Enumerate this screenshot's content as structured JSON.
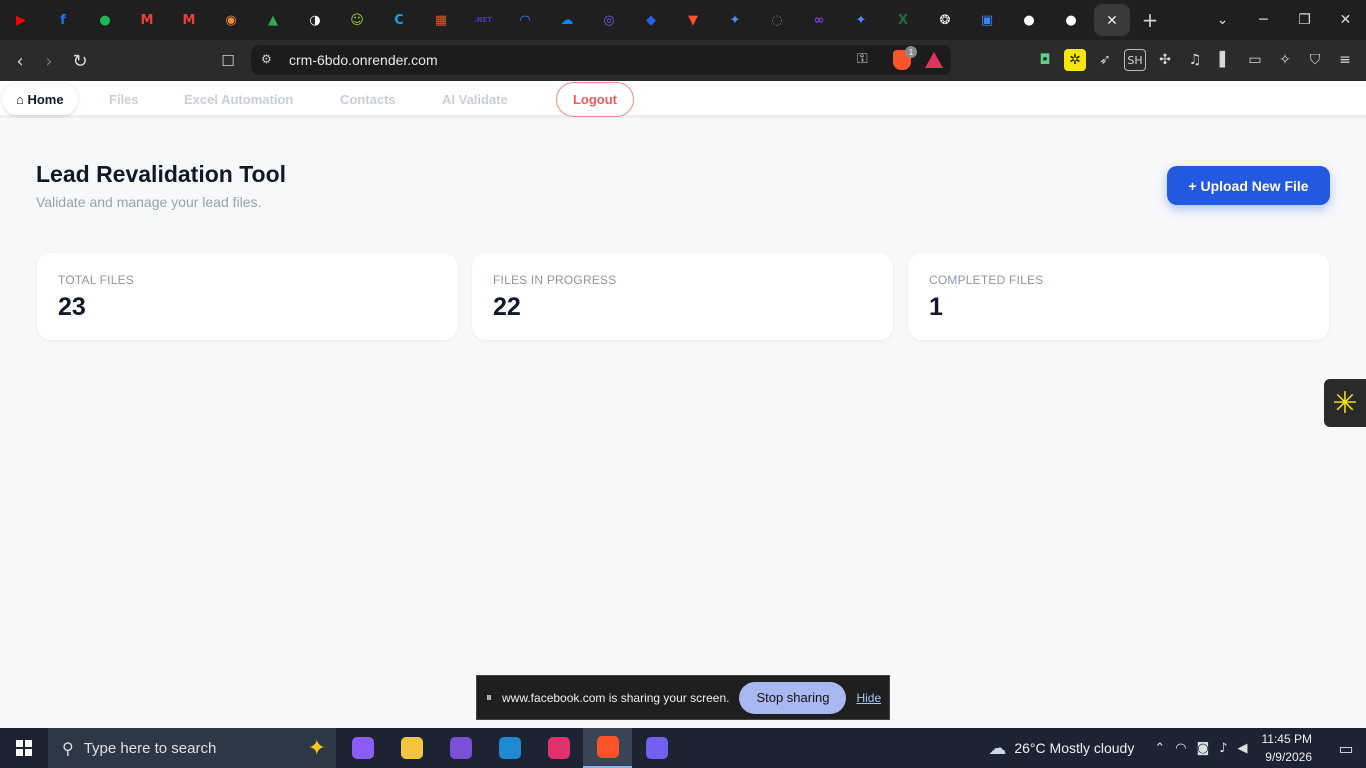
{
  "browser": {
    "tab_favicons": [
      {
        "name": "youtube",
        "color": "#ff0000",
        "glyph": "▶"
      },
      {
        "name": "facebook",
        "color": "#1877f2",
        "glyph": "f"
      },
      {
        "name": "chat",
        "color": "#1db954",
        "glyph": "●"
      },
      {
        "name": "gmail",
        "color": "#ea4335",
        "glyph": "M"
      },
      {
        "name": "gmail",
        "color": "#ea4335",
        "glyph": "M"
      },
      {
        "name": "app-orange",
        "color": "#f08c3a",
        "glyph": "◉"
      },
      {
        "name": "drive",
        "color": "#34a853",
        "glyph": "▲"
      },
      {
        "name": "app-bw",
        "color": "#ffffff",
        "glyph": "◑"
      },
      {
        "name": "app-green",
        "color": "#9acd32",
        "glyph": "☺"
      },
      {
        "name": "app-c",
        "color": "#0ea5e9",
        "glyph": "C"
      },
      {
        "name": "microsoft",
        "color": "#f25022",
        "glyph": "▦"
      },
      {
        "name": "dotnet",
        "color": "#512bd4",
        "glyph": ".NET"
      },
      {
        "name": "app-arc",
        "color": "#3b82f6",
        "glyph": "◠"
      },
      {
        "name": "onedrive",
        "color": "#0a84ff",
        "glyph": "☁"
      },
      {
        "name": "app-ring",
        "color": "#6366f1",
        "glyph": "◎"
      },
      {
        "name": "app-blue",
        "color": "#2563eb",
        "glyph": "◆"
      },
      {
        "name": "brave",
        "color": "#fb542b",
        "glyph": "▼"
      },
      {
        "name": "gemini",
        "color": "#4f8bff",
        "glyph": "✦"
      },
      {
        "name": "app-dotted",
        "color": "#777777",
        "glyph": "◌"
      },
      {
        "name": "meta",
        "color": "#7c3aed",
        "glyph": "∞"
      },
      {
        "name": "gemini",
        "color": "#4f8bff",
        "glyph": "✦"
      },
      {
        "name": "excel",
        "color": "#1d6f42",
        "glyph": "X"
      },
      {
        "name": "openai",
        "color": "#ffffff",
        "glyph": "❂"
      },
      {
        "name": "app-grid",
        "color": "#3b82f6",
        "glyph": "▣"
      },
      {
        "name": "github",
        "color": "#ffffff",
        "glyph": "●"
      },
      {
        "name": "github",
        "color": "#ffffff",
        "glyph": "●"
      }
    ],
    "active_tab_close": "✕",
    "new_tab": "+",
    "url": "crm-6bdo.onrender.com",
    "shield_badge": "1"
  },
  "app": {
    "nav": {
      "home": "⌂ Home",
      "files": "Files",
      "excel": "Excel Automation",
      "contacts": "Contacts",
      "ai_validate": "AI Validate",
      "logout": "Logout"
    },
    "title": "Lead Revalidation Tool",
    "subtitle": "Validate and manage your lead files.",
    "upload_button": "+ Upload New File",
    "stats": [
      {
        "label": "TOTAL FILES",
        "value": "23"
      },
      {
        "label": "FILES IN PROGRESS",
        "value": "22"
      },
      {
        "label": "COMPLETED FILES",
        "value": "1"
      }
    ]
  },
  "share_banner": {
    "text": "www.facebook.com is sharing your screen.",
    "stop": "Stop sharing",
    "hide": "Hide"
  },
  "taskbar": {
    "search_placeholder": "Type here to search",
    "weather": "26°C  Mostly cloudy",
    "time": "11:45 PM",
    "date": "9/9/2026",
    "apps": [
      {
        "name": "copilot",
        "color": "#8b5cf6"
      },
      {
        "name": "file-explorer",
        "color": "#f5c542"
      },
      {
        "name": "visual-studio",
        "color": "#7b4fd6"
      },
      {
        "name": "vscode",
        "color": "#1f8ad2"
      },
      {
        "name": "instagram",
        "color": "#e1306c"
      },
      {
        "name": "brave",
        "color": "#fb542b"
      },
      {
        "name": "viber",
        "color": "#7360f2"
      }
    ]
  }
}
